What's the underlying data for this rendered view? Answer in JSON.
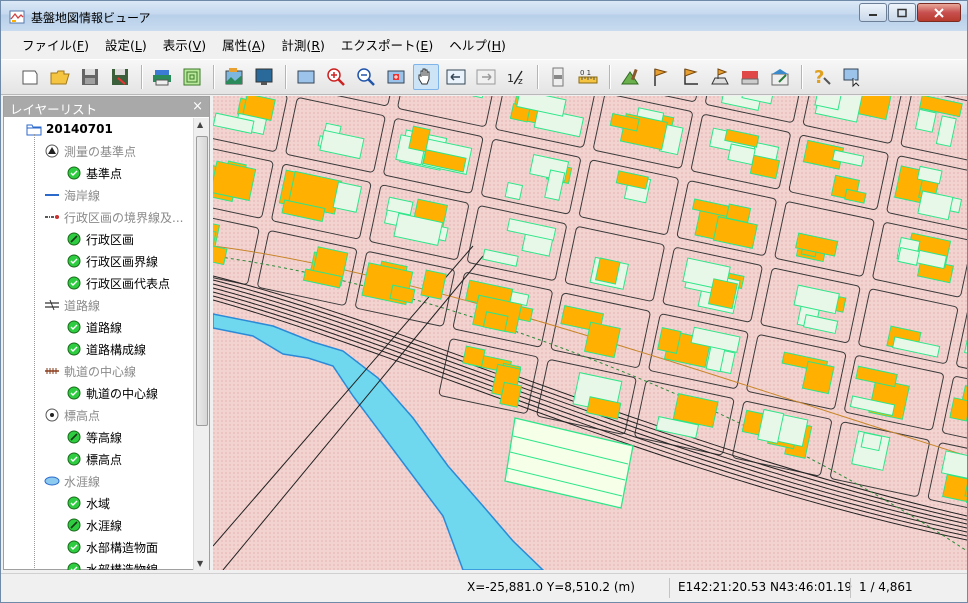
{
  "window": {
    "title": "基盤地図情報ビューア"
  },
  "menu": [
    {
      "label": "ファイル(",
      "key": "F",
      "tail": ")"
    },
    {
      "label": "設定(",
      "key": "L",
      "tail": ")"
    },
    {
      "label": "表示(",
      "key": "V",
      "tail": ")"
    },
    {
      "label": "属性(",
      "key": "A",
      "tail": ")"
    },
    {
      "label": "計測(",
      "key": "R",
      "tail": ")"
    },
    {
      "label": "エクスポート(",
      "key": "E",
      "tail": ")"
    },
    {
      "label": "ヘルプ(",
      "key": "H",
      "tail": ")"
    }
  ],
  "layer_panel": {
    "title": "レイヤーリスト",
    "close": "×",
    "root": "20140701",
    "groups": [
      {
        "label": "測量の基準点",
        "icon": "triangle-point-icon",
        "children": [
          "基準点"
        ]
      },
      {
        "label": "海岸線",
        "icon": "blue-line-icon",
        "children": []
      },
      {
        "label": "行政区画の境界線及...",
        "icon": "boundary-line-icon",
        "children": [
          "行政区画",
          "行政区画界線",
          "行政区画代表点"
        ]
      },
      {
        "label": "道路線",
        "icon": "road-icon",
        "children": [
          "道路線",
          "道路構成線"
        ]
      },
      {
        "label": "軌道の中心線",
        "icon": "railway-icon",
        "children": [
          "軌道の中心線"
        ]
      },
      {
        "label": "標高点",
        "icon": "elevation-point-icon",
        "children": [
          "等高線",
          "標高点"
        ]
      },
      {
        "label": "水涯線",
        "icon": "water-icon",
        "children": [
          "水域",
          "水涯線",
          "水部構造物面",
          "水部構造物線"
        ]
      }
    ]
  },
  "status": {
    "xy": "X=-25,881.0 Y=8,510.2 (m)",
    "latlon": "E142:21:20.53 N43:46:01.19",
    "scale": "1 / 4,861"
  },
  "colors": {
    "map_background": "#f3d3d0",
    "building": "#ffb000",
    "building_outline": "#2ee68a",
    "water": "#6fd8ee",
    "panel_header": "#a9a9a9"
  }
}
